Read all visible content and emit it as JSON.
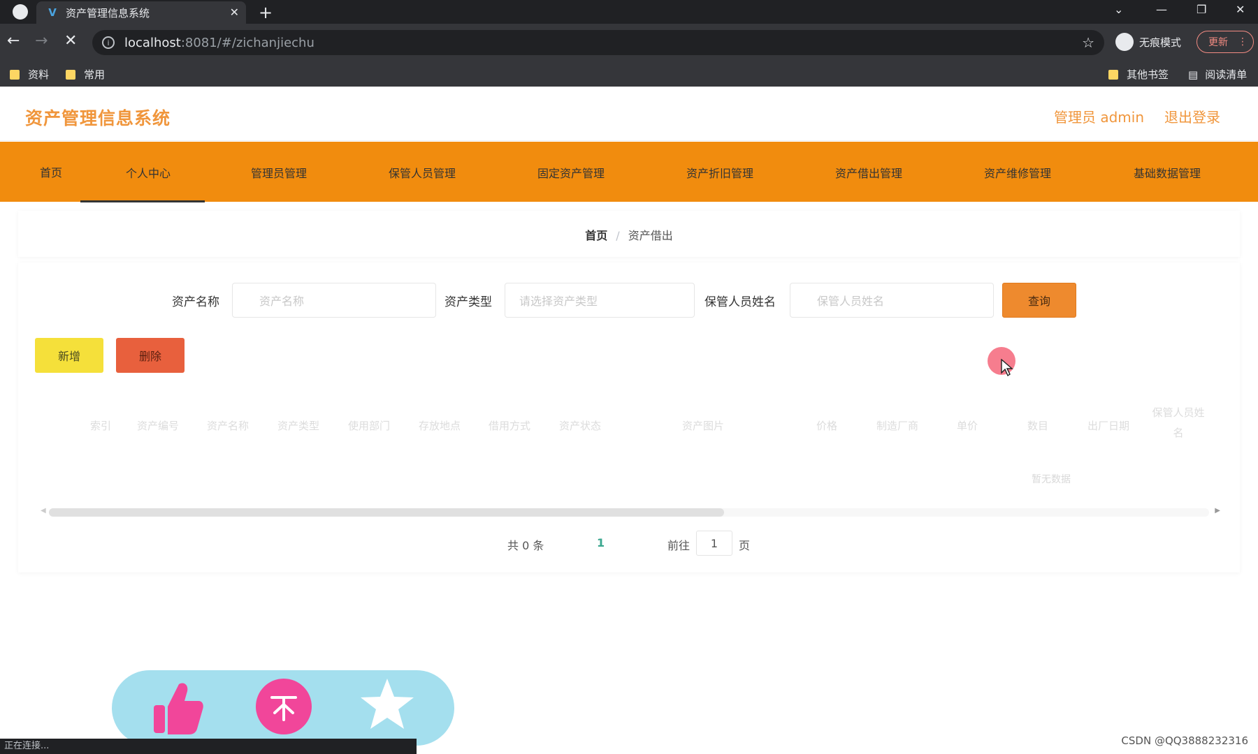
{
  "browser": {
    "tab_title": "资产管理信息系统",
    "url_host": "localhost",
    "url_path": ":8081/#/zichanjiechu",
    "incognito_label": "无痕模式",
    "update_label": "更新",
    "bookmarks": [
      "资料",
      "常用"
    ],
    "other_bookmarks": "其他书签",
    "reading_list": "阅读清单",
    "status_text": "正在连接..."
  },
  "header": {
    "title": "资产管理信息系统",
    "admin_label": "管理员 admin",
    "logout_label": "退出登录",
    "accent_color": "#f0963c"
  },
  "nav": {
    "items": [
      "首页",
      "个人中心",
      "管理员管理",
      "保管人员管理",
      "固定资产管理",
      "资产折旧管理",
      "资产借出管理",
      "资产维修管理",
      "基础数据管理"
    ],
    "active_index": 1,
    "bg_color": "#f18c0e"
  },
  "breadcrumb": {
    "home": "首页",
    "separator": "/",
    "current": "资产借出"
  },
  "search": {
    "name_label": "资产名称",
    "name_placeholder": "资产名称",
    "type_label": "资产类型",
    "type_placeholder": "请选择资产类型",
    "keeper_label": "保管人员姓名",
    "keeper_placeholder": "保管人员姓名",
    "query_label": "查询"
  },
  "actions": {
    "add_label": "新增",
    "delete_label": "删除"
  },
  "table": {
    "columns": [
      "索引",
      "资产编号",
      "资产名称",
      "资产类型",
      "使用部门",
      "存放地点",
      "借用方式",
      "资产状态",
      "资产图片",
      "价格",
      "制造厂商",
      "单价",
      "数目",
      "出厂日期",
      "保管人员姓名"
    ],
    "empty_text": "暂无数据"
  },
  "pagination": {
    "total_text": "共 0 条",
    "current_page": "1",
    "goto_label": "前往",
    "goto_value": "1",
    "page_suffix": "页"
  },
  "watermark": "CSDN @QQ3888232316"
}
